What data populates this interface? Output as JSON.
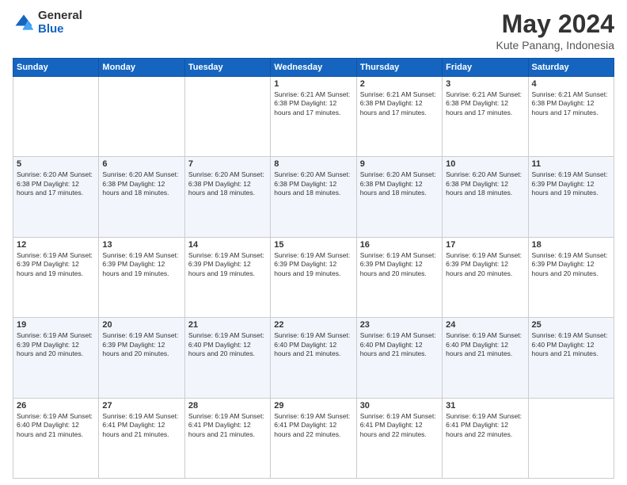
{
  "logo": {
    "general": "General",
    "blue": "Blue"
  },
  "title": "May 2024",
  "location": "Kute Panang, Indonesia",
  "weekdays": [
    "Sunday",
    "Monday",
    "Tuesday",
    "Wednesday",
    "Thursday",
    "Friday",
    "Saturday"
  ],
  "weeks": [
    [
      {
        "day": "",
        "info": ""
      },
      {
        "day": "",
        "info": ""
      },
      {
        "day": "",
        "info": ""
      },
      {
        "day": "1",
        "info": "Sunrise: 6:21 AM\nSunset: 6:38 PM\nDaylight: 12 hours and 17 minutes."
      },
      {
        "day": "2",
        "info": "Sunrise: 6:21 AM\nSunset: 6:38 PM\nDaylight: 12 hours and 17 minutes."
      },
      {
        "day": "3",
        "info": "Sunrise: 6:21 AM\nSunset: 6:38 PM\nDaylight: 12 hours and 17 minutes."
      },
      {
        "day": "4",
        "info": "Sunrise: 6:21 AM\nSunset: 6:38 PM\nDaylight: 12 hours and 17 minutes."
      }
    ],
    [
      {
        "day": "5",
        "info": "Sunrise: 6:20 AM\nSunset: 6:38 PM\nDaylight: 12 hours and 17 minutes."
      },
      {
        "day": "6",
        "info": "Sunrise: 6:20 AM\nSunset: 6:38 PM\nDaylight: 12 hours and 18 minutes."
      },
      {
        "day": "7",
        "info": "Sunrise: 6:20 AM\nSunset: 6:38 PM\nDaylight: 12 hours and 18 minutes."
      },
      {
        "day": "8",
        "info": "Sunrise: 6:20 AM\nSunset: 6:38 PM\nDaylight: 12 hours and 18 minutes."
      },
      {
        "day": "9",
        "info": "Sunrise: 6:20 AM\nSunset: 6:38 PM\nDaylight: 12 hours and 18 minutes."
      },
      {
        "day": "10",
        "info": "Sunrise: 6:20 AM\nSunset: 6:38 PM\nDaylight: 12 hours and 18 minutes."
      },
      {
        "day": "11",
        "info": "Sunrise: 6:19 AM\nSunset: 6:39 PM\nDaylight: 12 hours and 19 minutes."
      }
    ],
    [
      {
        "day": "12",
        "info": "Sunrise: 6:19 AM\nSunset: 6:39 PM\nDaylight: 12 hours and 19 minutes."
      },
      {
        "day": "13",
        "info": "Sunrise: 6:19 AM\nSunset: 6:39 PM\nDaylight: 12 hours and 19 minutes."
      },
      {
        "day": "14",
        "info": "Sunrise: 6:19 AM\nSunset: 6:39 PM\nDaylight: 12 hours and 19 minutes."
      },
      {
        "day": "15",
        "info": "Sunrise: 6:19 AM\nSunset: 6:39 PM\nDaylight: 12 hours and 19 minutes."
      },
      {
        "day": "16",
        "info": "Sunrise: 6:19 AM\nSunset: 6:39 PM\nDaylight: 12 hours and 20 minutes."
      },
      {
        "day": "17",
        "info": "Sunrise: 6:19 AM\nSunset: 6:39 PM\nDaylight: 12 hours and 20 minutes."
      },
      {
        "day": "18",
        "info": "Sunrise: 6:19 AM\nSunset: 6:39 PM\nDaylight: 12 hours and 20 minutes."
      }
    ],
    [
      {
        "day": "19",
        "info": "Sunrise: 6:19 AM\nSunset: 6:39 PM\nDaylight: 12 hours and 20 minutes."
      },
      {
        "day": "20",
        "info": "Sunrise: 6:19 AM\nSunset: 6:39 PM\nDaylight: 12 hours and 20 minutes."
      },
      {
        "day": "21",
        "info": "Sunrise: 6:19 AM\nSunset: 6:40 PM\nDaylight: 12 hours and 20 minutes."
      },
      {
        "day": "22",
        "info": "Sunrise: 6:19 AM\nSunset: 6:40 PM\nDaylight: 12 hours and 21 minutes."
      },
      {
        "day": "23",
        "info": "Sunrise: 6:19 AM\nSunset: 6:40 PM\nDaylight: 12 hours and 21 minutes."
      },
      {
        "day": "24",
        "info": "Sunrise: 6:19 AM\nSunset: 6:40 PM\nDaylight: 12 hours and 21 minutes."
      },
      {
        "day": "25",
        "info": "Sunrise: 6:19 AM\nSunset: 6:40 PM\nDaylight: 12 hours and 21 minutes."
      }
    ],
    [
      {
        "day": "26",
        "info": "Sunrise: 6:19 AM\nSunset: 6:40 PM\nDaylight: 12 hours and 21 minutes."
      },
      {
        "day": "27",
        "info": "Sunrise: 6:19 AM\nSunset: 6:41 PM\nDaylight: 12 hours and 21 minutes."
      },
      {
        "day": "28",
        "info": "Sunrise: 6:19 AM\nSunset: 6:41 PM\nDaylight: 12 hours and 21 minutes."
      },
      {
        "day": "29",
        "info": "Sunrise: 6:19 AM\nSunset: 6:41 PM\nDaylight: 12 hours and 22 minutes."
      },
      {
        "day": "30",
        "info": "Sunrise: 6:19 AM\nSunset: 6:41 PM\nDaylight: 12 hours and 22 minutes."
      },
      {
        "day": "31",
        "info": "Sunrise: 6:19 AM\nSunset: 6:41 PM\nDaylight: 12 hours and 22 minutes."
      },
      {
        "day": "",
        "info": ""
      }
    ]
  ]
}
